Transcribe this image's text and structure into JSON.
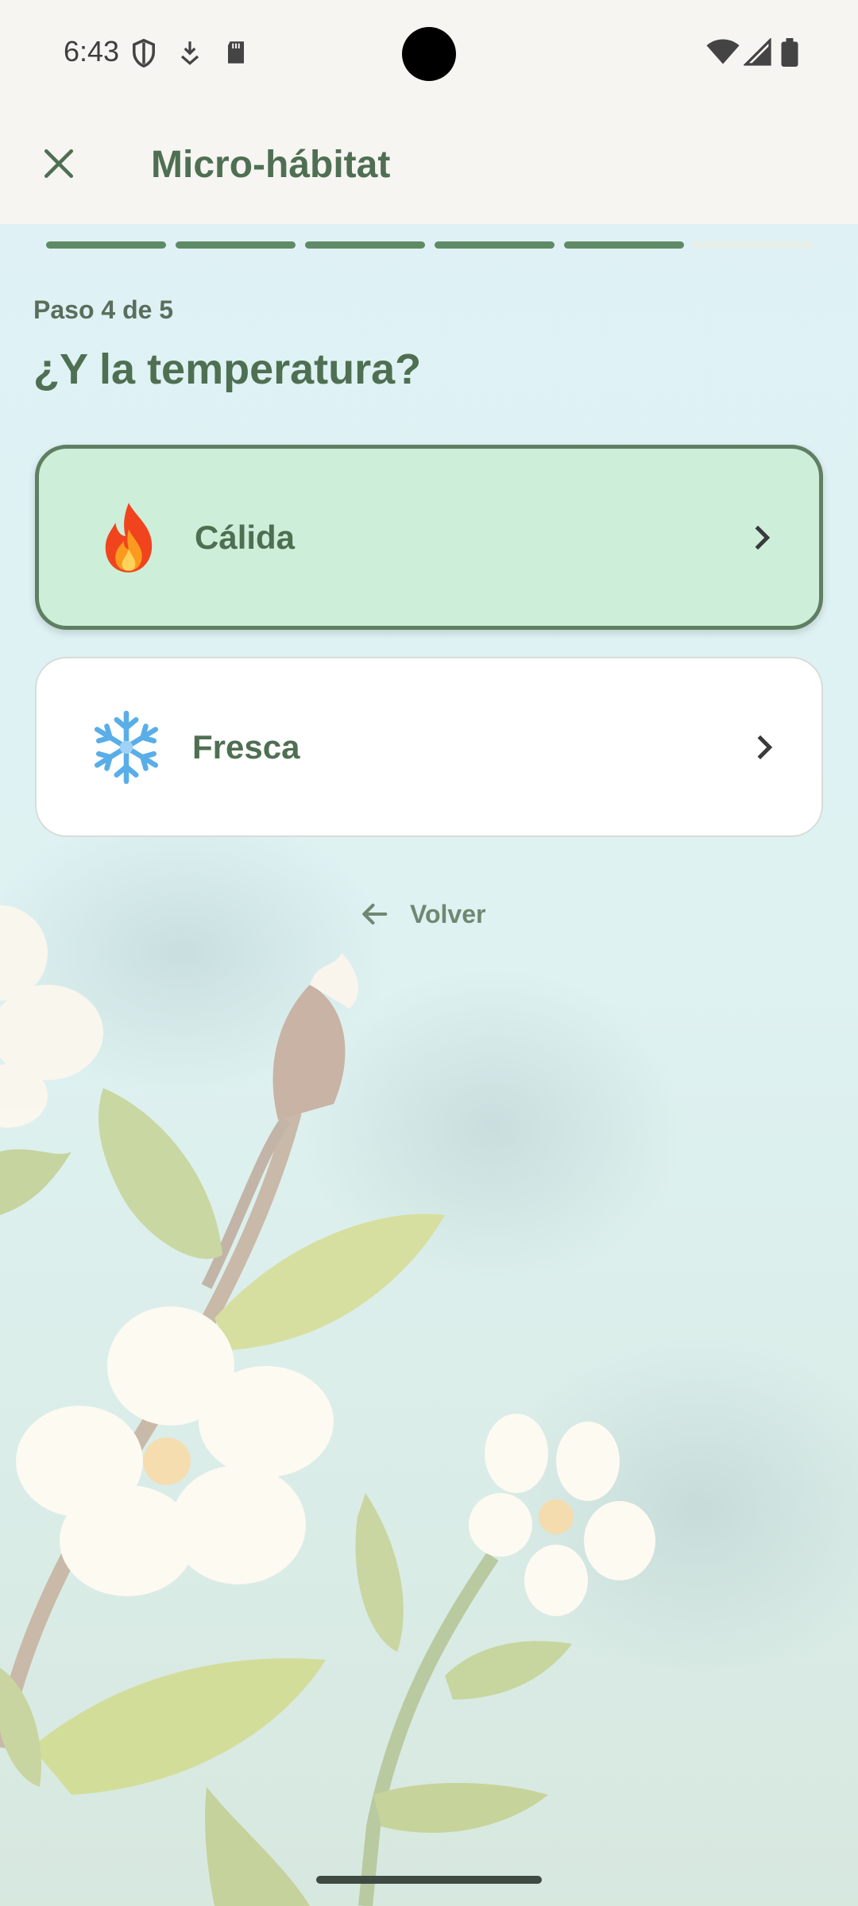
{
  "status_bar": {
    "time": "6:43",
    "icons": [
      "shield-icon",
      "download-icon",
      "sd-card-icon",
      "wifi-icon",
      "signal-icon",
      "battery-icon"
    ]
  },
  "app_bar": {
    "title": "Micro-hábitat",
    "close_icon": "close-icon"
  },
  "progress": {
    "current_step": 5,
    "total_steps": 6
  },
  "step": {
    "label": "Paso 4 de 5",
    "question": "¿Y la temperatura?"
  },
  "options": [
    {
      "emoji": "🔥",
      "label": "Cálida",
      "selected": true,
      "icon": "chevron-right-icon"
    },
    {
      "emoji": "❄️",
      "label": "Fresca",
      "selected": false,
      "icon": "chevron-right-icon"
    }
  ],
  "back": {
    "label": "Volver",
    "icon": "arrow-left-icon"
  },
  "colors": {
    "accent": "#4f6f52",
    "selected_bg": "#cdeed8",
    "progress": "#5f8a66"
  }
}
